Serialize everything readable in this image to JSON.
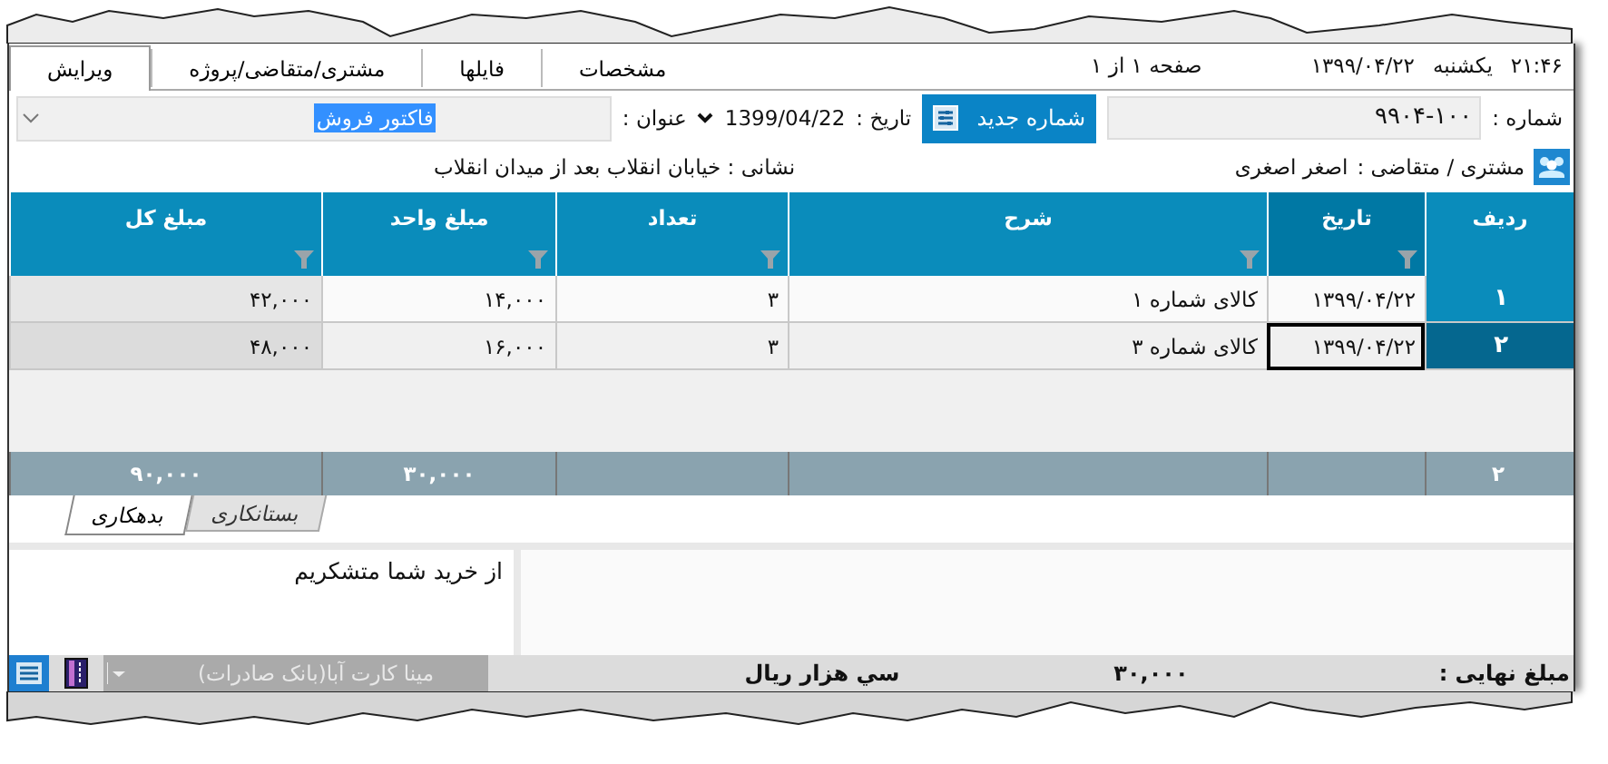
{
  "header": {
    "tabs": [
      {
        "label": "مشخصات",
        "selected": false
      },
      {
        "label": "فایلها",
        "selected": false
      },
      {
        "label": "مشتری/متقاضی/پروژه",
        "selected": false
      },
      {
        "label": "ویرایش",
        "selected": true
      }
    ],
    "time": "۲۱:۴۶",
    "weekday": "یکشنبه",
    "date": "۱۳۹۹/۰۴/۲۲",
    "page": "صفحه ۱ از ۱"
  },
  "form": {
    "number_label": "شماره :",
    "number": "۹۹۰۴-۱۰۰",
    "new_number_button": "شماره جدید",
    "date_label": "تاریخ :",
    "date": "1399/04/22",
    "title_label": "عنوان :",
    "title": "فاکتور فروش",
    "customer_label": "مشتری / متقاضی :",
    "customer": "اصغر اصغری",
    "address": "نشانی : خیابان انقلاب بعد از میدان انقلاب"
  },
  "table": {
    "columns": [
      {
        "label": "ردیف",
        "filter": false,
        "selected": false
      },
      {
        "label": "تاریخ",
        "filter": true,
        "selected": true
      },
      {
        "label": "شرح",
        "filter": true,
        "selected": false
      },
      {
        "label": "تعداد",
        "filter": true,
        "selected": false
      },
      {
        "label": "مبلغ واحد",
        "filter": true,
        "selected": false
      },
      {
        "label": "مبلغ کل",
        "filter": true,
        "selected": false
      }
    ],
    "rows": [
      {
        "selected": false,
        "cells": [
          {
            "text": "۱",
            "focused": false
          },
          {
            "text": "۱۳۹۹/۰۴/۲۲",
            "focused": false
          },
          {
            "text": "کالای شماره ۱",
            "focused": false
          },
          {
            "text": "۳",
            "focused": false
          },
          {
            "text": "۱۴,۰۰۰",
            "focused": false
          },
          {
            "text": "۴۲,۰۰۰",
            "focused": false
          }
        ]
      },
      {
        "selected": true,
        "cells": [
          {
            "text": "۲",
            "focused": false
          },
          {
            "text": "۱۳۹۹/۰۴/۲۲",
            "focused": true
          },
          {
            "text": "کالای شماره ۳",
            "focused": false
          },
          {
            "text": "۳",
            "focused": false
          },
          {
            "text": "۱۶,۰۰۰",
            "focused": false
          },
          {
            "text": "۴۸,۰۰۰",
            "focused": false
          }
        ]
      }
    ],
    "totals": {
      "count": "۲",
      "unit_total": "۳۰,۰۰۰",
      "grand_total": "۹۰,۰۰۰"
    }
  },
  "bottom_tabs": [
    {
      "label": "بستانکاری",
      "selected": false
    },
    {
      "label": "بدهکاری",
      "selected": true
    }
  ],
  "note": "از خرید شما متشکریم",
  "status_bar": {
    "total_label": "مبلغ نهایی :",
    "total": "۳۰,۰۰۰",
    "total_words": "سي هزار ريال",
    "account": "مینا کارت آبا(بانک صادرات)",
    "account_disabled": true
  }
}
